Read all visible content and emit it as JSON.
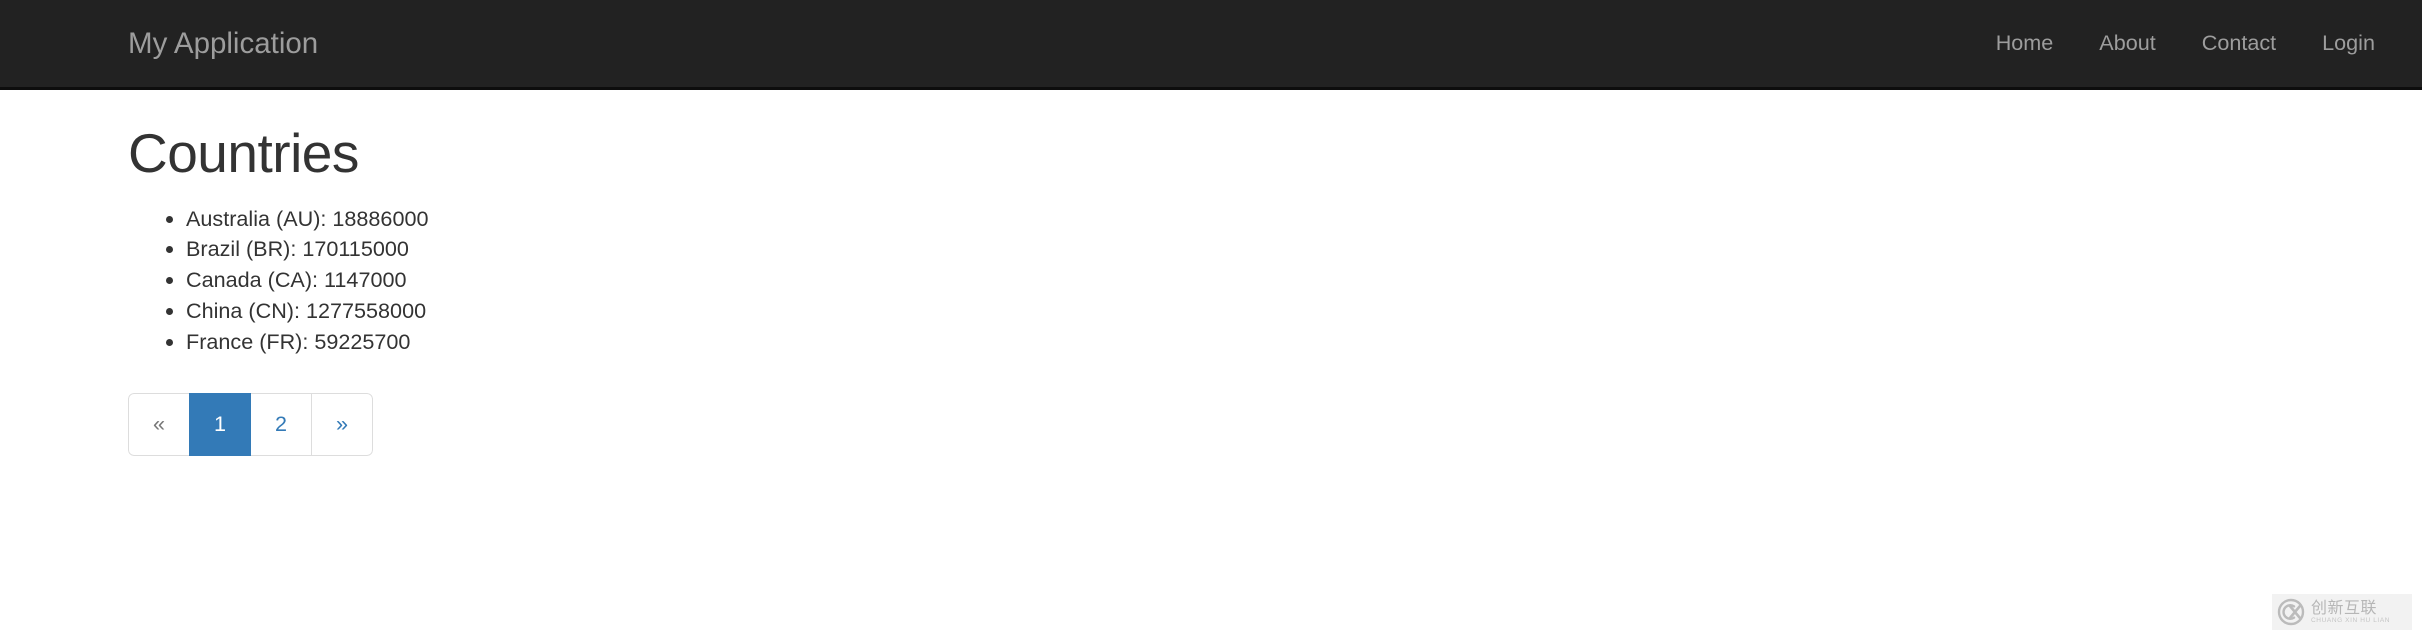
{
  "navbar": {
    "brand": "My Application",
    "brand_color": "#9d9d9d",
    "background_color": "#222222",
    "links": [
      {
        "label": "Home"
      },
      {
        "label": "About"
      },
      {
        "label": "Contact"
      },
      {
        "label": "Login"
      }
    ]
  },
  "main": {
    "title": "Countries",
    "items": [
      {
        "text": "Australia (AU): 18886000",
        "name": "Australia",
        "code": "AU",
        "population": 18886000
      },
      {
        "text": "Brazil (BR): 170115000",
        "name": "Brazil",
        "code": "BR",
        "population": 170115000
      },
      {
        "text": "Canada (CA): 1147000",
        "name": "Canada",
        "code": "CA",
        "population": 1147000
      },
      {
        "text": "China (CN): 1277558000",
        "name": "China",
        "code": "CN",
        "population": 1277558000
      },
      {
        "text": "France (FR): 59225700",
        "name": "France",
        "code": "FR",
        "population": 59225700
      }
    ]
  },
  "pagination": {
    "prev_label": "«",
    "next_label": "»",
    "pages": [
      {
        "label": "1",
        "active": true
      },
      {
        "label": "2",
        "active": false
      }
    ],
    "active_page": "1",
    "active_color": "#337ab7",
    "link_color": "#337ab7",
    "disabled_color": "#777777"
  },
  "watermark": {
    "logo": "cx-circle-logo",
    "cn_text": "创新互联",
    "pinyin_text": "CHUANG XIN HU LIAN"
  }
}
